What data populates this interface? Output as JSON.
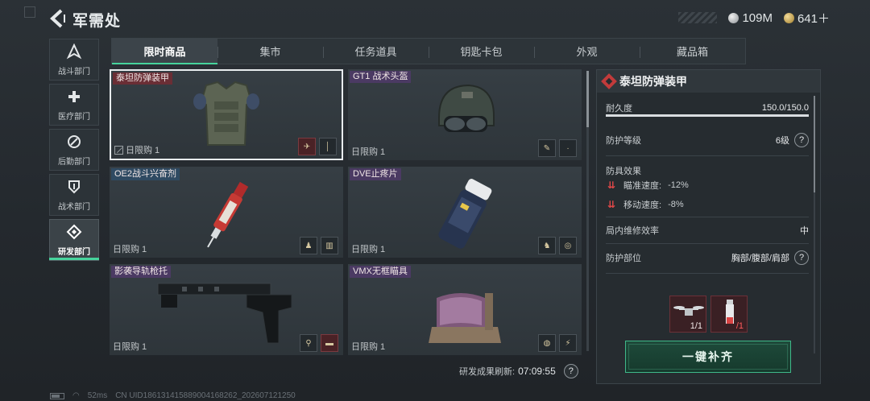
{
  "header": {
    "title": "军需处",
    "currency_silver": "109M",
    "currency_gold": "641＋"
  },
  "departments": [
    {
      "label": "战斗部门",
      "icon": "combat-icon"
    },
    {
      "label": "医疗部门",
      "icon": "medical-cross-icon"
    },
    {
      "label": "后勤部门",
      "icon": "logistics-icon"
    },
    {
      "label": "战术部门",
      "icon": "tactical-shield-icon"
    },
    {
      "label": "研发部门",
      "icon": "research-icon",
      "active": true
    }
  ],
  "tabs": [
    "限时商品",
    "集市",
    "任务道具",
    "钥匙卡包",
    "外观",
    "藏品箱"
  ],
  "products": [
    {
      "name": "泰坦防弹装甲",
      "limit": "日限购 1",
      "rarity_color": "#6a2e35",
      "selected": true
    },
    {
      "name": "GT1 战术头盔",
      "limit": "日限购 1",
      "rarity_color": "#4b3a63"
    },
    {
      "name": "OE2战斗兴奋剂",
      "limit": "日限购 1",
      "rarity_color": "#2f4a62"
    },
    {
      "name": "DVE止疼片",
      "limit": "日限购 1",
      "rarity_color": "#4b3a63"
    },
    {
      "name": "影袭导轨枪托",
      "limit": "日限购 1",
      "rarity_color": "#4b3a63"
    },
    {
      "name": "VMX无框瞄具",
      "limit": "日限购 1",
      "rarity_color": "#4b3a63"
    }
  ],
  "refresh": {
    "label": "研发成果刷新:",
    "time": "07:09:55",
    "help": "?"
  },
  "detail": {
    "name": "泰坦防弹装甲",
    "durability_label": "耐久度",
    "durability_value": "150.0/150.0",
    "durability_fraction": 1.0,
    "protection_level_label": "防护等级",
    "protection_level_value": "6级",
    "effects_label": "防具效果",
    "effects": [
      {
        "label": "瞄准速度:",
        "value": "-12%"
      },
      {
        "label": "移动速度:",
        "value": "-8%"
      }
    ],
    "repair_label": "局内维修效率",
    "repair_value": "中",
    "area_label": "防护部位",
    "area_value": "胸部/腹部/肩部",
    "help": "?",
    "requirements": [
      {
        "icon": "drone-icon",
        "count": "1/1"
      },
      {
        "icon": "syringe-icon",
        "count": "/1"
      }
    ],
    "restock_label": "一键补齐"
  },
  "status": {
    "ping": "52ms",
    "uid": "CN UID1861314158890041682​62_202607121250"
  },
  "colors": {
    "accent": "#46d39c",
    "danger": "#c23b3b"
  }
}
